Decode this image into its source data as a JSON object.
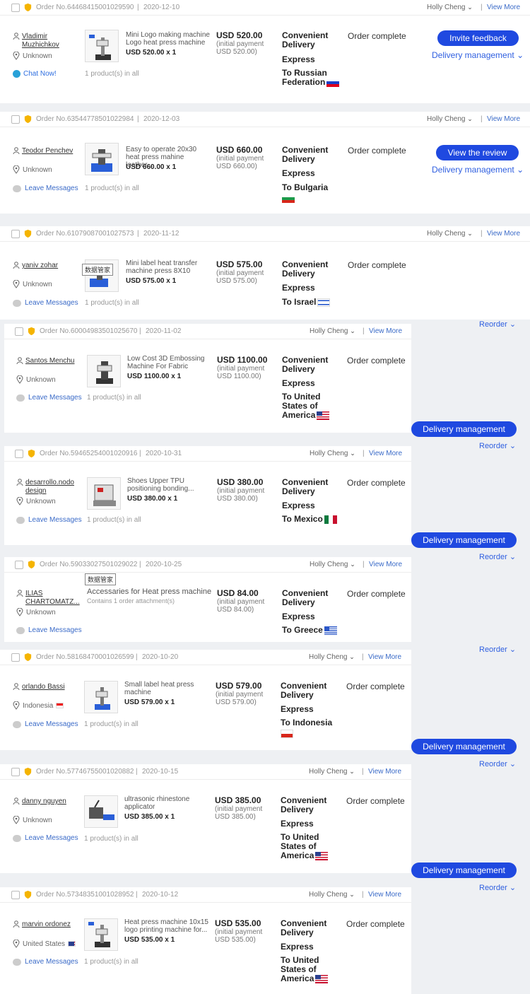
{
  "common": {
    "sales_person": "Holly Cheng",
    "separator": "|",
    "view_more": "View More",
    "buyer_unknown": "Unknown",
    "leave_messages": "Leave Messages",
    "chat_now": "Chat Now!",
    "products_in_all": "1 product(s) in all",
    "initial_payment": "(initial payment",
    "shipping_line1": "Convenient",
    "shipping_line2": "Delivery",
    "shipping_line3": "Express",
    "status": "Order complete",
    "delivery_management": "Delivery management",
    "reorder": "Reorder",
    "tag_cn": "数据管家",
    "chevron": "⌄",
    "qty": " x 1"
  },
  "orders": [
    {
      "no": "Order No.64468415001029590",
      "date": "2020-12-10",
      "buyer": [
        "Vladimir",
        "Muzhichkov"
      ],
      "location": "Unknown",
      "title": "Mini Logo making machine Logo heat press machine",
      "price": "USD 520.00",
      "initial": "USD 520.00)",
      "dest": "To Russian Federation",
      "flag": "ru",
      "primary": "Invite feedback"
    },
    {
      "no": "Order No.63544778501022984",
      "date": "2020-12-03",
      "buyer": [
        "Teodor Penchev"
      ],
      "location": "Unknown",
      "title": "Easy to operate 20x30 heat press mahine leather...",
      "price": "USD 660.00",
      "initial": "USD 660.00)",
      "dest": "To Bulgaria",
      "flag": "bg",
      "primary": "View the review"
    },
    {
      "no": "Order No.61079087001027573",
      "date": "2020-11-12",
      "buyer": [
        "yaniv zohar"
      ],
      "location": "Unknown",
      "title": "Mini label heat transfer machine press 8X10",
      "price": "USD 575.00",
      "initial": "USD 575.00)",
      "dest": "To Israel",
      "flag": "il"
    },
    {
      "no": "Order No.60004983501025670",
      "date": "2020-11-02",
      "buyer": [
        "Santos Menchu"
      ],
      "location": "Unknown",
      "title": "Low Cost 3D Embossing Machine For Fabric",
      "price": "USD 1100.00",
      "initial": "USD 1100.00)",
      "dest": "To United States of America",
      "flag": "us"
    },
    {
      "no": "Order No.59465254001020916",
      "date": "2020-10-31",
      "buyer": [
        "desarrollo.nodo",
        "design"
      ],
      "location": "Unknown",
      "title": "Shoes Upper TPU positioning bonding...",
      "price": "USD 380.00",
      "initial": "USD 380.00)",
      "dest": "To Mexico",
      "flag": "mx"
    },
    {
      "no": "Order No.59033027501029022",
      "date": "2020-10-25",
      "buyer": [
        "ILIAS",
        "CHARTOMATZ..."
      ],
      "location": "Unknown",
      "title": "Accessaries for Heat press machine",
      "subtitle": "Contains 1 order attachment(s)",
      "price": "USD 84.00",
      "initial": "USD 84.00)",
      "dest": "To Greece",
      "flag": "gr"
    },
    {
      "no": "Order No.58168470001026599",
      "date": "2020-10-20",
      "buyer": [
        "orlando Bassi"
      ],
      "location": "Indonesia",
      "title": "Small label heat press machine",
      "price": "USD 579.00",
      "initial": "USD 579.00)",
      "dest": "To Indonesia",
      "flag": "id"
    },
    {
      "no": "Order No.57746755001020882",
      "date": "2020-10-15",
      "buyer": [
        "danny nguyen"
      ],
      "location": "Unknown",
      "title": "ultrasonic rhinestone applicator",
      "price": "USD 385.00",
      "initial": "USD 385.00)",
      "dest": "To United States of America",
      "flag": "us"
    },
    {
      "no": "Order No.57348351001028952",
      "date": "2020-10-12",
      "buyer": [
        "marvin ordonez"
      ],
      "location": "United States",
      "title": "Heat press machine 10x15 logo printing machine for...",
      "price": "USD 535.00",
      "initial": "USD 535.00)",
      "dest": "To United States of America",
      "flag": "us"
    }
  ]
}
